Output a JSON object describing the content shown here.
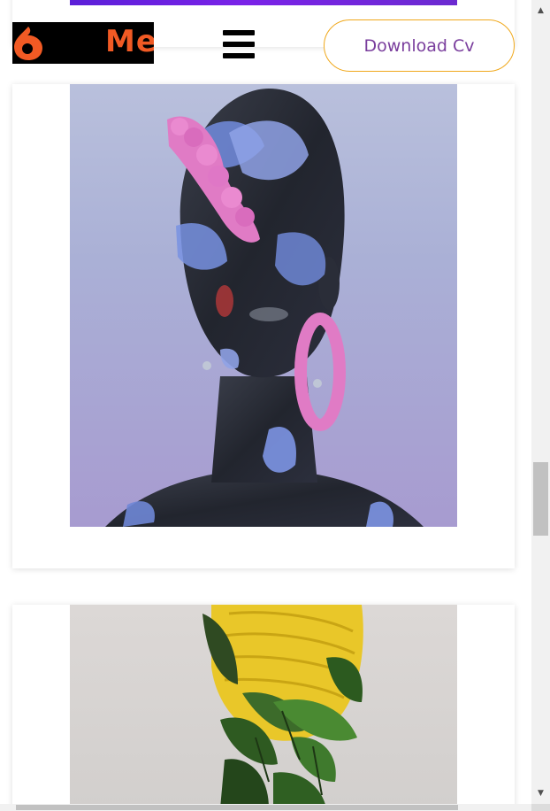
{
  "header": {
    "logo_text": "Me",
    "menu_icon": "hamburger-icon",
    "download_label": "Download Cv"
  },
  "gallery": {
    "items": [
      {
        "name": "sculpture-head-flowers",
        "description_icon": "image"
      },
      {
        "name": "sculpture-head-leaves",
        "description_icon": "image"
      }
    ]
  },
  "colors": {
    "accent_orange": "#f15a24",
    "button_border": "#f0a81b",
    "button_text": "#7a3e9d",
    "strip_purple": "#6b22e0"
  }
}
